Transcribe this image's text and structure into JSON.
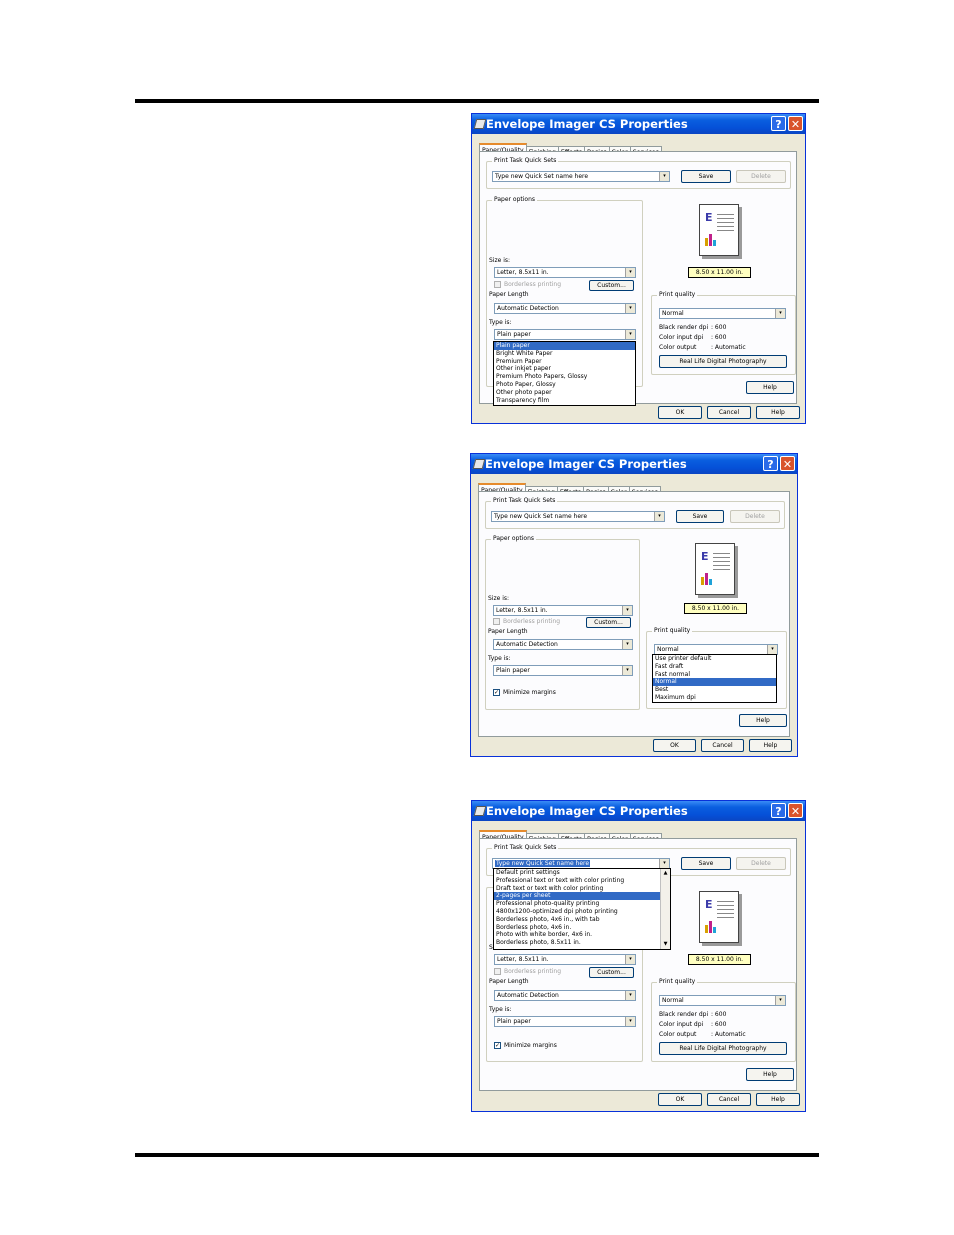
{
  "dialog_title": "Envelope Imager CS Properties",
  "title_help_glyph": "?",
  "title_close_glyph": "✕",
  "tabs": [
    "Paper/Quality",
    "Finishing",
    "Effects",
    "Basics",
    "Color",
    "Services"
  ],
  "quick_sets": {
    "legend": "Print Task Quick Sets",
    "value": "Type new Quick Set name here",
    "save": "Save",
    "delete": "Delete"
  },
  "paper_options": {
    "legend": "Paper options",
    "size_label": "Size is:",
    "size_value": "Letter, 8.5x11 in.",
    "borderless": "Borderless printing",
    "custom": "Custom...",
    "length_label": "Paper Length",
    "length_value": "Automatic Detection",
    "type_label": "Type is:",
    "type_value": "Plain paper",
    "minimize_margins": "Minimize margins"
  },
  "preview": {
    "size_text": "8.50 x 11.00 in."
  },
  "print_quality": {
    "legend": "Print quality",
    "value": "Normal",
    "black_dpi_label": "Black render dpi",
    "black_dpi_value": ": 600",
    "color_dpi_label": "Color input dpi",
    "color_dpi_value": ": 600",
    "color_out_label": "Color output",
    "color_out_value": ": Automatic",
    "rldp": "Real Life Digital Photography"
  },
  "buttons": {
    "help": "Help",
    "ok": "OK",
    "cancel": "Cancel"
  },
  "paper_type_options": [
    "Plain paper",
    "Bright White Paper",
    "Premium Paper",
    "Other inkjet paper",
    "Premium Photo Papers, Glossy",
    "Photo Paper, Glossy",
    "Other photo paper",
    "Transparency film"
  ],
  "paper_type_selected": "Plain paper",
  "print_quality_options": [
    "Use printer default",
    "Fast draft",
    "Fast normal",
    "Normal",
    "Best",
    "Maximum dpi"
  ],
  "print_quality_selected": "Normal",
  "quick_set_options": [
    "Default print settings",
    "Professional text or text with color printing",
    "Draft text or text with color printing",
    "2-pages per sheet",
    "Professional photo-quality printing",
    "4800x1200-optimized dpi photo printing",
    "Borderless photo, 4x6 in., with tab",
    "Borderless photo, 4x6 in.",
    "Photo with white border, 4x6 in.",
    "Borderless photo, 8.5x11 in."
  ],
  "quick_set_selected": "2-pages per sheet",
  "check_glyph": "✓",
  "combo_arrow": "▾",
  "scroll_up": "▲",
  "scroll_down": "▼"
}
